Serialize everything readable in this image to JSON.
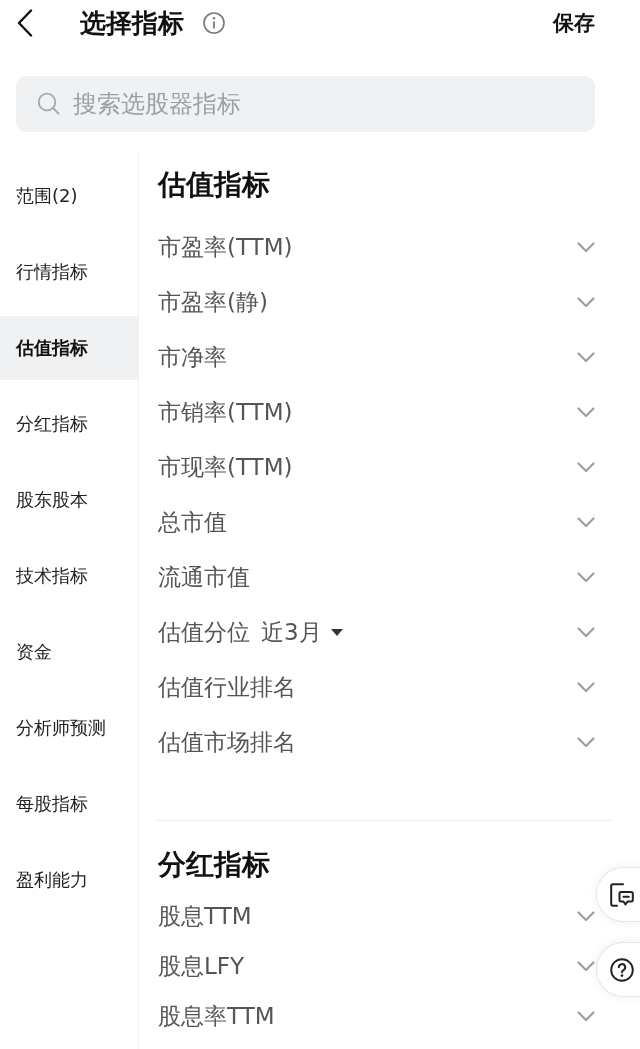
{
  "header": {
    "title": "选择指标",
    "save": "保存"
  },
  "search": {
    "placeholder": "搜索选股器指标"
  },
  "sidebar": {
    "items": [
      {
        "label": "范围(2)",
        "selected": false
      },
      {
        "label": "行情指标",
        "selected": false
      },
      {
        "label": "估值指标",
        "selected": true
      },
      {
        "label": "分红指标",
        "selected": false
      },
      {
        "label": "股东股本",
        "selected": false
      },
      {
        "label": "技术指标",
        "selected": false
      },
      {
        "label": "资金",
        "selected": false
      },
      {
        "label": "分析师预测",
        "selected": false
      },
      {
        "label": "每股指标",
        "selected": false
      },
      {
        "label": "盈利能力",
        "selected": false
      }
    ]
  },
  "sections": [
    {
      "title": "估值指标",
      "items": [
        {
          "kind": "plain",
          "label": "市盈率(TTM)",
          "expanded": false
        },
        {
          "kind": "plain",
          "label": "市盈率(静)",
          "expanded": false
        },
        {
          "kind": "plain",
          "label": "市净率",
          "expanded": false
        },
        {
          "kind": "plain",
          "label": "市销率(TTM)",
          "expanded": false
        },
        {
          "kind": "plain",
          "label": "市现率(TTM)",
          "expanded": false
        },
        {
          "kind": "plain",
          "label": "总市值",
          "expanded": false
        },
        {
          "kind": "plain",
          "label": "流通市值",
          "expanded": false
        },
        {
          "kind": "dropdown",
          "label": "估值分位",
          "option": "近3月",
          "expanded": false
        },
        {
          "kind": "plain",
          "label": "估值行业排名",
          "expanded": false
        },
        {
          "kind": "plain",
          "label": "估值市场排名",
          "expanded": false
        }
      ]
    },
    {
      "title": "分红指标",
      "items": [
        {
          "kind": "plain",
          "label": "股息TTM",
          "expanded": false
        },
        {
          "kind": "plain",
          "label": "股息LFY",
          "expanded": false
        },
        {
          "kind": "plain",
          "label": "股息率TTM",
          "expanded": false
        }
      ]
    }
  ],
  "floating_buttons": [
    {
      "kind": "feedback"
    },
    {
      "kind": "help"
    }
  ]
}
